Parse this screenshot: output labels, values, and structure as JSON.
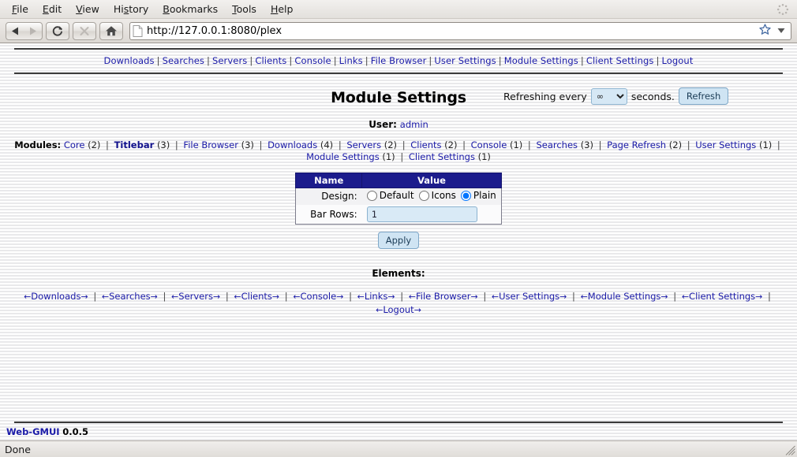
{
  "browser": {
    "menus": [
      "File",
      "Edit",
      "View",
      "History",
      "Bookmarks",
      "Tools",
      "Help"
    ],
    "menu_accesskeys": [
      "F",
      "E",
      "V",
      "H",
      "B",
      "T",
      "H"
    ],
    "url": "http://127.0.0.1:8080/plex",
    "back_title": "Back",
    "forward_title": "Forward",
    "reload_title": "Reload",
    "stop_title": "Stop",
    "home_title": "Home",
    "bookmark_title": "Bookmark this page",
    "status": "Done"
  },
  "topnav": {
    "items": [
      "Downloads",
      "Searches",
      "Servers",
      "Clients",
      "Console",
      "Links",
      "File Browser",
      "User Settings",
      "Module Settings",
      "Client Settings",
      "Logout"
    ]
  },
  "header": {
    "title": "Module Settings",
    "refresh_prefix": "Refreshing every",
    "refresh_value": "∞",
    "refresh_options": [
      "∞"
    ],
    "refresh_suffix": "seconds.",
    "refresh_button": "Refresh"
  },
  "user": {
    "label": "User:",
    "name": "admin"
  },
  "modules": {
    "label": "Modules:",
    "items": [
      {
        "name": "Core",
        "count": "(2)",
        "current": false
      },
      {
        "name": "Titlebar",
        "count": "(3)",
        "current": true
      },
      {
        "name": "File Browser",
        "count": "(3)",
        "current": false
      },
      {
        "name": "Downloads",
        "count": "(4)",
        "current": false
      },
      {
        "name": "Servers",
        "count": "(2)",
        "current": false
      },
      {
        "name": "Clients",
        "count": "(2)",
        "current": false
      },
      {
        "name": "Console",
        "count": "(1)",
        "current": false
      },
      {
        "name": "Searches",
        "count": "(3)",
        "current": false
      },
      {
        "name": "Page Refresh",
        "count": "(2)",
        "current": false
      },
      {
        "name": "User Settings",
        "count": "(1)",
        "current": false
      },
      {
        "name": "Module Settings",
        "count": "(1)",
        "current": false
      },
      {
        "name": "Client Settings",
        "count": "(1)",
        "current": false
      }
    ]
  },
  "settings_table": {
    "headers": [
      "Name",
      "Value"
    ],
    "rows": [
      {
        "label": "Design:",
        "type": "radio",
        "options": [
          {
            "label": "Default",
            "checked": false
          },
          {
            "label": "Icons",
            "checked": false
          },
          {
            "label": "Plain",
            "checked": true
          }
        ]
      },
      {
        "label": "Bar Rows:",
        "type": "text",
        "value": "1"
      }
    ],
    "apply_button": "Apply"
  },
  "elements": {
    "title": "Elements:",
    "left_arrow": "←",
    "right_arrow": "→",
    "items": [
      "Downloads",
      "Searches",
      "Servers",
      "Clients",
      "Console",
      "Links",
      "File Browser",
      "User Settings",
      "Module Settings",
      "Client Settings",
      "Logout"
    ]
  },
  "footer": {
    "product": "Web-GMUI",
    "version": "0.0.5"
  }
}
